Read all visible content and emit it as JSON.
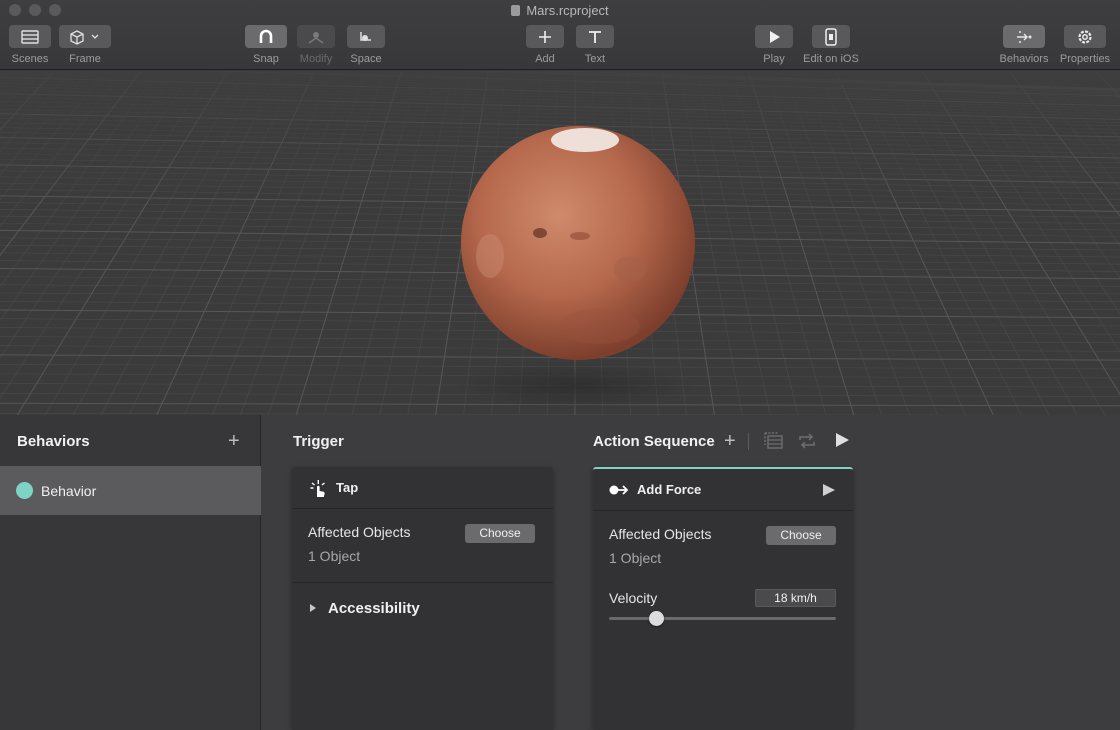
{
  "window": {
    "title": "Mars.rcproject"
  },
  "toolbar": {
    "scenes": "Scenes",
    "frame": "Frame",
    "snap": "Snap",
    "modify": "Modify",
    "space": "Space",
    "add": "Add",
    "text": "Text",
    "play": "Play",
    "edit_on_ios": "Edit on iOS",
    "behaviors": "Behaviors",
    "properties": "Properties"
  },
  "behaviors_panel": {
    "title": "Behaviors",
    "items": [
      {
        "label": "Behavior",
        "color": "#7fd3c4"
      }
    ]
  },
  "trigger": {
    "title": "Trigger",
    "card_title": "Tap",
    "affected_label": "Affected Objects",
    "choose_label": "Choose",
    "object_count": "1 Object",
    "accessibility_label": "Accessibility"
  },
  "action_sequence": {
    "title": "Action Sequence",
    "card_title": "Add Force",
    "affected_label": "Affected Objects",
    "choose_label": "Choose",
    "object_count": "1 Object",
    "velocity_label": "Velocity",
    "velocity_value": "18 km/h",
    "velocity_slider_fraction": 0.21,
    "accent_color": "#7fd3c4"
  }
}
